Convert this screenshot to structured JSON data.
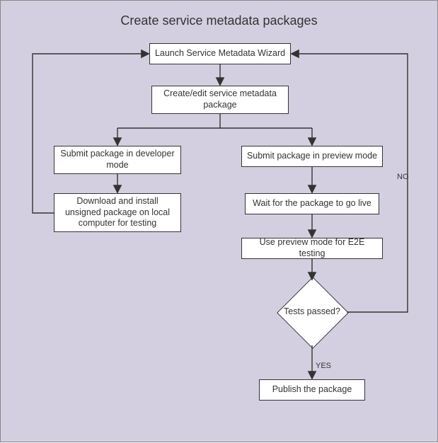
{
  "title": "Create service metadata packages",
  "nodes": {
    "launch": "Launch Service Metadata Wizard",
    "create": "Create/edit service metadata package",
    "submit_dev": "Submit package in developer mode",
    "download": "Download and install unsigned package on local computer for testing",
    "submit_preview": "Submit package in preview mode",
    "wait_live": "Wait for the package to go live",
    "use_preview": "Use preview mode for E2E testing",
    "decision": "Tests passed?",
    "publish": "Publish the package"
  },
  "edges": {
    "yes": "YES",
    "no": "NO"
  }
}
